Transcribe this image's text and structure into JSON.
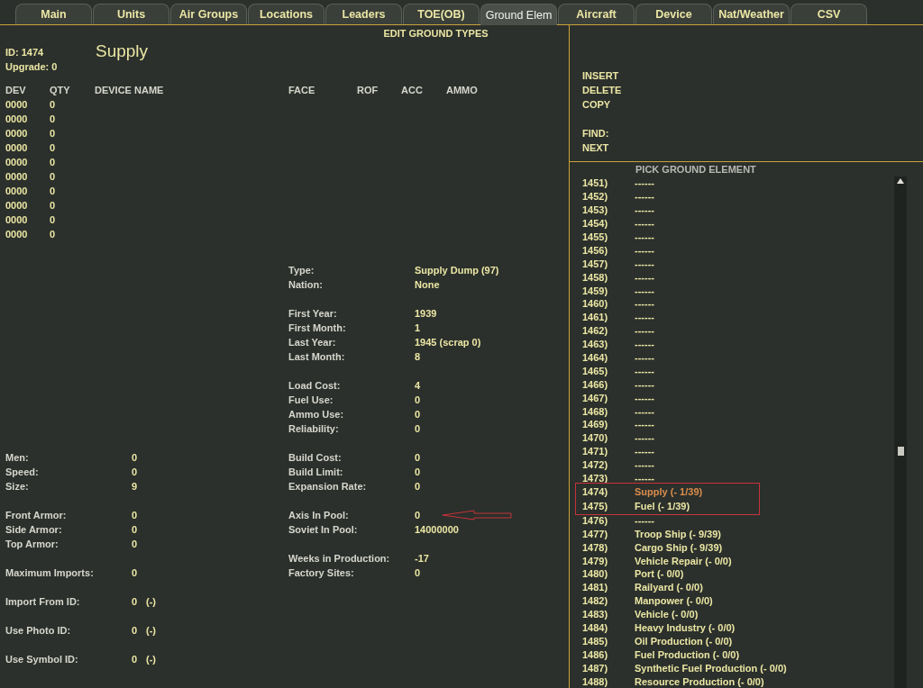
{
  "tabs": [
    {
      "label": "Main",
      "selected": false
    },
    {
      "label": "Units",
      "selected": false
    },
    {
      "label": "Air Groups",
      "selected": false
    },
    {
      "label": "Locations",
      "selected": false
    },
    {
      "label": "Leaders",
      "selected": false
    },
    {
      "label": "TOE(OB)",
      "selected": false
    },
    {
      "label": "Ground Elem",
      "selected": true
    },
    {
      "label": "Aircraft",
      "selected": false
    },
    {
      "label": "Device",
      "selected": false
    },
    {
      "label": "Nat/Weather",
      "selected": false
    },
    {
      "label": "CSV",
      "selected": false
    }
  ],
  "editor": {
    "title": "EDIT GROUND TYPES",
    "id": "ID: 1474",
    "upgrade": "Upgrade: 0",
    "name": "Supply",
    "device_columns": [
      "DEV",
      "QTY",
      "DEVICE NAME",
      "FACE",
      "ROF",
      "ACC",
      "AMMO"
    ],
    "devices": [
      {
        "dev": "0000",
        "qty": "0"
      },
      {
        "dev": "0000",
        "qty": "0"
      },
      {
        "dev": "0000",
        "qty": "0"
      },
      {
        "dev": "0000",
        "qty": "0"
      },
      {
        "dev": "0000",
        "qty": "0"
      },
      {
        "dev": "0000",
        "qty": "0"
      },
      {
        "dev": "0000",
        "qty": "0"
      },
      {
        "dev": "0000",
        "qty": "0"
      },
      {
        "dev": "0000",
        "qty": "0"
      },
      {
        "dev": "0000",
        "qty": "0"
      }
    ],
    "stats": [
      [
        {
          "label": "Men:",
          "value": "0"
        },
        {
          "label": "Speed:",
          "value": "0"
        },
        {
          "label": "Size:",
          "value": "9"
        }
      ],
      [
        {
          "label": "Front Armor:",
          "value": "0"
        },
        {
          "label": "Side Armor:",
          "value": "0"
        },
        {
          "label": "Top Armor:",
          "value": "0"
        }
      ],
      [
        {
          "label": "Maximum Imports:",
          "value": "0"
        }
      ],
      [
        {
          "label": "Import From ID:",
          "value": "0",
          "suffix": "(-)"
        }
      ],
      [
        {
          "label": "Use Photo ID:",
          "value": "0",
          "suffix": "(-)"
        }
      ],
      [
        {
          "label": "Use Symbol ID:",
          "value": "0",
          "suffix": "(-)"
        }
      ]
    ],
    "properties": [
      [
        {
          "label": "Type:",
          "value": "Supply Dump (97)",
          "annotated": false
        },
        {
          "label": "Nation:",
          "value": "None",
          "annotated": false
        }
      ],
      [
        {
          "label": "First Year:",
          "value": "1939",
          "annotated": false
        },
        {
          "label": "First Month:",
          "value": "1",
          "annotated": false
        },
        {
          "label": "Last Year:",
          "value": "1945 (scrap 0)",
          "annotated": false
        },
        {
          "label": "Last Month:",
          "value": "8",
          "annotated": false
        }
      ],
      [
        {
          "label": "Load Cost:",
          "value": "4",
          "annotated": false
        },
        {
          "label": "Fuel Use:",
          "value": "0",
          "annotated": false
        },
        {
          "label": "Ammo Use:",
          "value": "0",
          "annotated": false
        },
        {
          "label": "Reliability:",
          "value": "0",
          "annotated": false
        }
      ],
      [
        {
          "label": "Build Cost:",
          "value": "0",
          "annotated": false
        },
        {
          "label": "Build Limit:",
          "value": "0",
          "annotated": false
        },
        {
          "label": "Expansion Rate:",
          "value": "0",
          "annotated": false
        }
      ],
      [
        {
          "label": "Axis In Pool:",
          "value": "0",
          "annotated": true
        },
        {
          "label": "Soviet In Pool:",
          "value": "14000000",
          "annotated": false
        }
      ],
      [
        {
          "label": "Weeks in Production:",
          "value": "-17",
          "annotated": false
        },
        {
          "label": "Factory Sites:",
          "value": "0",
          "annotated": false
        }
      ]
    ]
  },
  "commands": [
    [
      "INSERT",
      "DELETE",
      "COPY"
    ],
    [
      "FIND:",
      "NEXT"
    ]
  ],
  "picker": {
    "title": "PICK GROUND ELEMENT",
    "items": [
      {
        "id": "1451)",
        "name": "------",
        "selected": false,
        "annotated": false
      },
      {
        "id": "1452)",
        "name": "------",
        "selected": false,
        "annotated": false
      },
      {
        "id": "1453)",
        "name": "------",
        "selected": false,
        "annotated": false
      },
      {
        "id": "1454)",
        "name": "------",
        "selected": false,
        "annotated": false
      },
      {
        "id": "1455)",
        "name": "------",
        "selected": false,
        "annotated": false
      },
      {
        "id": "1456)",
        "name": "------",
        "selected": false,
        "annotated": false
      },
      {
        "id": "1457)",
        "name": "------",
        "selected": false,
        "annotated": false
      },
      {
        "id": "1458)",
        "name": "------",
        "selected": false,
        "annotated": false
      },
      {
        "id": "1459)",
        "name": "------",
        "selected": false,
        "annotated": false
      },
      {
        "id": "1460)",
        "name": "------",
        "selected": false,
        "annotated": false
      },
      {
        "id": "1461)",
        "name": "------",
        "selected": false,
        "annotated": false
      },
      {
        "id": "1462)",
        "name": "------",
        "selected": false,
        "annotated": false
      },
      {
        "id": "1463)",
        "name": "------",
        "selected": false,
        "annotated": false
      },
      {
        "id": "1464)",
        "name": "------",
        "selected": false,
        "annotated": false
      },
      {
        "id": "1465)",
        "name": "------",
        "selected": false,
        "annotated": false
      },
      {
        "id": "1466)",
        "name": "------",
        "selected": false,
        "annotated": false
      },
      {
        "id": "1467)",
        "name": "------",
        "selected": false,
        "annotated": false
      },
      {
        "id": "1468)",
        "name": "------",
        "selected": false,
        "annotated": false
      },
      {
        "id": "1469)",
        "name": "------",
        "selected": false,
        "annotated": false
      },
      {
        "id": "1470)",
        "name": "------",
        "selected": false,
        "annotated": false
      },
      {
        "id": "1471)",
        "name": "------",
        "selected": false,
        "annotated": false
      },
      {
        "id": "1472)",
        "name": "------",
        "selected": false,
        "annotated": false
      },
      {
        "id": "1473)",
        "name": "------",
        "selected": false,
        "annotated": false
      },
      {
        "id": "1474)",
        "name": "Supply  (- 1/39)",
        "selected": true,
        "annotated": true
      },
      {
        "id": "1475)",
        "name": "Fuel  (- 1/39)",
        "selected": false,
        "annotated": true
      },
      {
        "id": "1476)",
        "name": "------",
        "selected": false,
        "annotated": false
      },
      {
        "id": "1477)",
        "name": "Troop Ship  (- 9/39)",
        "selected": false,
        "annotated": false
      },
      {
        "id": "1478)",
        "name": "Cargo Ship  (- 9/39)",
        "selected": false,
        "annotated": false
      },
      {
        "id": "1479)",
        "name": "Vehicle Repair  (- 0/0)",
        "selected": false,
        "annotated": false
      },
      {
        "id": "1480)",
        "name": "Port  (- 0/0)",
        "selected": false,
        "annotated": false
      },
      {
        "id": "1481)",
        "name": "Railyard  (- 0/0)",
        "selected": false,
        "annotated": false
      },
      {
        "id": "1482)",
        "name": "Manpower  (- 0/0)",
        "selected": false,
        "annotated": false
      },
      {
        "id": "1483)",
        "name": "Vehicle  (- 0/0)",
        "selected": false,
        "annotated": false
      },
      {
        "id": "1484)",
        "name": "Heavy Industry  (- 0/0)",
        "selected": false,
        "annotated": false
      },
      {
        "id": "1485)",
        "name": "Oil Production  (- 0/0)",
        "selected": false,
        "annotated": false
      },
      {
        "id": "1486)",
        "name": "Fuel Production  (- 0/0)",
        "selected": false,
        "annotated": false
      },
      {
        "id": "1487)",
        "name": "Synthetic Fuel Production  (- 0/0)",
        "selected": false,
        "annotated": false
      },
      {
        "id": "1488)",
        "name": "Resource Production  (- 0/0)",
        "selected": false,
        "annotated": false
      }
    ]
  }
}
